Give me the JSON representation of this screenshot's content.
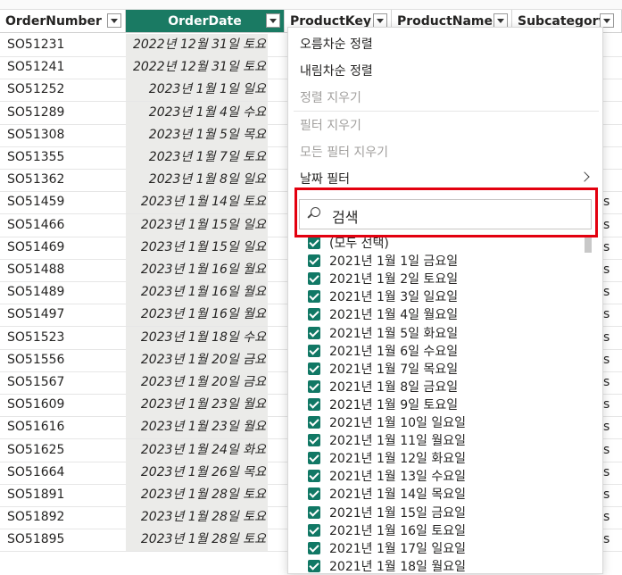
{
  "columns": [
    {
      "label": "OrderNumber"
    },
    {
      "label": "OrderDate"
    },
    {
      "label": "ProductKey"
    },
    {
      "label": "ProductName"
    },
    {
      "label": "Subcategory"
    }
  ],
  "rows": [
    {
      "order": "SO51231",
      "date": "2022년 12월 31일 토요"
    },
    {
      "order": "SO51241",
      "date": "2022년 12월 31일 토요"
    },
    {
      "order": "SO51252",
      "date": "2023년 1월 1일 일요"
    },
    {
      "order": "SO51289",
      "date": "2023년 1월 4일 수요"
    },
    {
      "order": "SO51308",
      "date": "2023년 1월 5일 목요"
    },
    {
      "order": "SO51355",
      "date": "2023년 1월 7일 토요"
    },
    {
      "order": "SO51362",
      "date": "2023년 1월 8일 일요"
    },
    {
      "order": "SO51459",
      "date": "2023년 1월 14일 토요"
    },
    {
      "order": "SO51466",
      "date": "2023년 1월 15일 일요"
    },
    {
      "order": "SO51469",
      "date": "2023년 1월 15일 일요"
    },
    {
      "order": "SO51488",
      "date": "2023년 1월 16일 월요"
    },
    {
      "order": "SO51489",
      "date": "2023년 1월 16일 월요"
    },
    {
      "order": "SO51497",
      "date": "2023년 1월 16일 월요"
    },
    {
      "order": "SO51523",
      "date": "2023년 1월 18일 수요"
    },
    {
      "order": "SO51556",
      "date": "2023년 1월 20일 금요"
    },
    {
      "order": "SO51567",
      "date": "2023년 1월 20일 금요"
    },
    {
      "order": "SO51609",
      "date": "2023년 1월 23일 월요"
    },
    {
      "order": "SO51616",
      "date": "2023년 1월 23일 월요"
    },
    {
      "order": "SO51625",
      "date": "2023년 1월 24일 화요"
    },
    {
      "order": "SO51664",
      "date": "2023년 1월 26일 목요"
    },
    {
      "order": "SO51891",
      "date": "2023년 1월 28일 토요"
    },
    {
      "order": "SO51892",
      "date": "2023년 1월 28일 토요"
    },
    {
      "order": "SO51895",
      "date": "2023년 1월 28일 토요"
    }
  ],
  "edge_fragment": "s",
  "menu": {
    "sort_asc": "오름차순 정렬",
    "sort_desc": "내림차순 정렬",
    "clear_sort": "정렬 지우기",
    "clear_filter": "필터 지우기",
    "clear_all_filters": "모든 필터 지우기",
    "date_filter": "날짜 필터",
    "search_value": "검색"
  },
  "filter_items": [
    {
      "label": "(모두 선택)",
      "checked": true
    },
    {
      "label": "2021년 1월 1일 금요일",
      "checked": true
    },
    {
      "label": "2021년 1월 2일 토요일",
      "checked": true
    },
    {
      "label": "2021년 1월 3일 일요일",
      "checked": true
    },
    {
      "label": "2021년 1월 4일 월요일",
      "checked": true
    },
    {
      "label": "2021년 1월 5일 화요일",
      "checked": true
    },
    {
      "label": "2021년 1월 6일 수요일",
      "checked": true
    },
    {
      "label": "2021년 1월 7일 목요일",
      "checked": true
    },
    {
      "label": "2021년 1월 8일 금요일",
      "checked": true
    },
    {
      "label": "2021년 1월 9일 토요일",
      "checked": true
    },
    {
      "label": "2021년 1월 10일 일요일",
      "checked": true
    },
    {
      "label": "2021년 1월 11일 월요일",
      "checked": true
    },
    {
      "label": "2021년 1월 12일 화요일",
      "checked": true
    },
    {
      "label": "2021년 1월 13일 수요일",
      "checked": true
    },
    {
      "label": "2021년 1월 14일 목요일",
      "checked": true
    },
    {
      "label": "2021년 1월 15일 금요일",
      "checked": true
    },
    {
      "label": "2021년 1월 16일 토요일",
      "checked": true
    },
    {
      "label": "2021년 1월 17일 일요일",
      "checked": true
    },
    {
      "label": "2021년 1월 18일 월요일",
      "checked": true
    }
  ],
  "colors": {
    "active_header": "#1a7a63",
    "checkbox": "#117865",
    "highlight": "#e3000f"
  }
}
